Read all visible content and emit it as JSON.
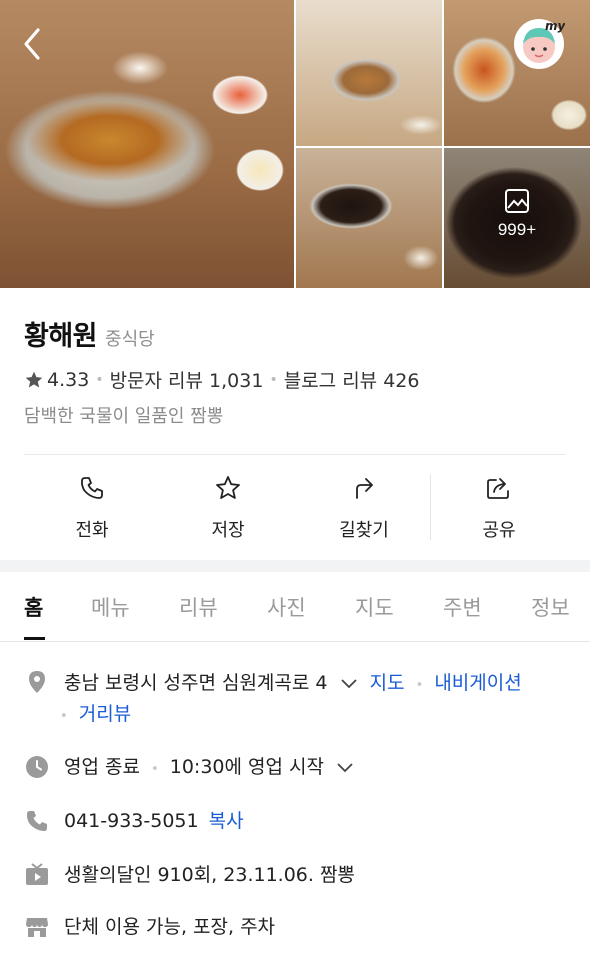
{
  "header": {
    "photo_count": "999+",
    "back_icon": "chevron-left-icon",
    "avatar_label": "my"
  },
  "place": {
    "name": "황해원",
    "category": "중식당",
    "rating": "4.33",
    "visitor_reviews": "방문자 리뷰 1,031",
    "blog_reviews": "블로그 리뷰 426",
    "description": "담백한 국물이 일품인 짬뽕"
  },
  "actions": {
    "call": "전화",
    "save": "저장",
    "route": "길찾기",
    "share": "공유"
  },
  "tabs": [
    "홈",
    "메뉴",
    "리뷰",
    "사진",
    "지도",
    "주변",
    "정보"
  ],
  "info": {
    "address": "충남 보령시 성주면 심원계곡로 4",
    "map_link": "지도",
    "navi_link": "내비게이션",
    "street_view_link": "거리뷰",
    "status": "영업 종료",
    "hours": "10:30에 영업 시작",
    "phone": "041-933-5051",
    "copy_link": "복사",
    "tv": "생활의달인 910회, 23.11.06. 짬뽕",
    "amenities": "단체 이용 가능, 포장, 주차"
  },
  "colors": {
    "link": "#1a5cd6",
    "muted": "#8e8e8e"
  }
}
